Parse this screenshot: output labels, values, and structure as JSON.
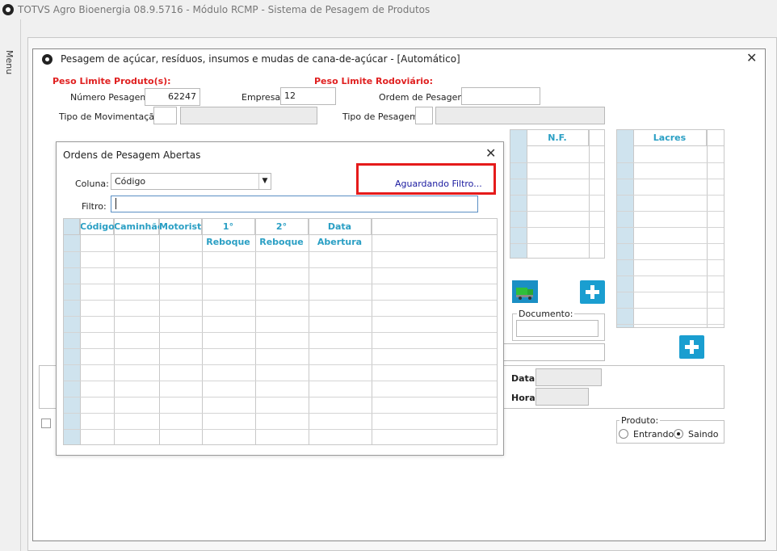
{
  "app": {
    "title": "TOTVS Agro Bioenergia 08.9.5716 - Módulo RCMP - Sistema de Pesagem de Produtos",
    "menu_label": "Menu"
  },
  "window": {
    "title": "Pesagem de açúcar, resíduos, insumos e mudas de cana-de-açúcar - [Automático]"
  },
  "form": {
    "peso_limite_produto": "Peso Limite Produto(s):",
    "peso_limite_rodoviario": "Peso Limite Rodoviário:",
    "numero_pesagem_label": "Número Pesagem:",
    "numero_pesagem_value": "62247",
    "empresa_label": "Empresa:",
    "empresa_value": "12",
    "ordem_pesagem_label": "Ordem de Pesagem:",
    "ordem_pesagem_value": "",
    "tipo_movimentacao_label": "Tipo de Movimentação:",
    "tipo_pesagem_label": "Tipo de Pesagem:",
    "documento_label": "Documento:",
    "data_label": "Data:",
    "hora_label": "Hora:",
    "produto_label": "Produto:",
    "entrando_label": "Entrando",
    "saindo_label": "Saindo"
  },
  "nf_grid": {
    "header": "N.F."
  },
  "lacres_grid": {
    "header": "Lacres"
  },
  "dialog": {
    "title": "Ordens de Pesagem Abertas",
    "coluna_label": "Coluna:",
    "coluna_value": "Código",
    "filtro_label": "Filtro:",
    "filtro_value": "",
    "status_text": "Aguardando Filtro...",
    "columns": [
      "Código",
      "Caminhão",
      "Motorista",
      "1° Reboque",
      "2° Reboque",
      "Data Abertura"
    ]
  },
  "colors": {
    "accent_blue": "#1a9ed0",
    "header_text": "#2a9fc4",
    "warning_red": "#e02020",
    "highlight_border": "#e51b1b"
  }
}
